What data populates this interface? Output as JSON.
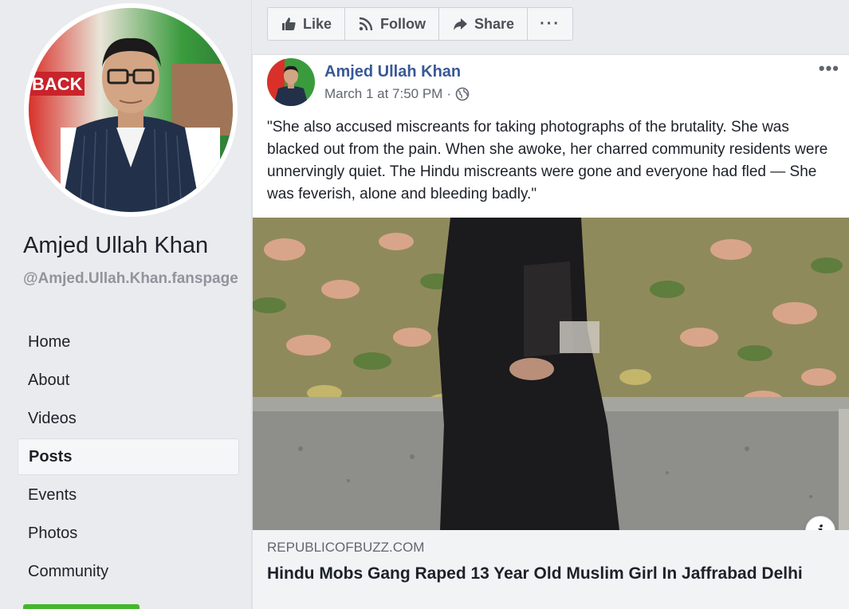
{
  "sidebar": {
    "page_name": "Amjed Ullah Khan",
    "handle": "@Amjed.Ullah.Khan.fanspage",
    "nav_items": [
      {
        "label": "Home",
        "active": false
      },
      {
        "label": "About",
        "active": false
      },
      {
        "label": "Videos",
        "active": false
      },
      {
        "label": "Posts",
        "active": true
      },
      {
        "label": "Events",
        "active": false
      },
      {
        "label": "Photos",
        "active": false
      },
      {
        "label": "Community",
        "active": false
      }
    ],
    "banner_text": "BACK"
  },
  "actions": {
    "like": "Like",
    "follow": "Follow",
    "share": "Share",
    "more": "···"
  },
  "post": {
    "author": "Amjed Ullah Khan",
    "date": "March 1 at 7:50 PM",
    "separator": "·",
    "menu": "•••",
    "text": "\"She also accused miscreants for taking photographs of the brutality. She was blacked out from the pain. When she awoke, her charred community residents were unnervingly quiet. The Hindu miscreants were gone and everyone had fled — She was feverish, alone and bleeding badly.\"",
    "info_glyph": "i",
    "link": {
      "domain": "REPUBLICOFBUZZ.COM",
      "title": "Hindu Mobs Gang Raped 13 Year Old Muslim Girl In Jaffrabad Delhi"
    }
  },
  "colors": {
    "accent_link": "#385898",
    "page_bg": "#e9ebee",
    "card_bg": "#ffffff",
    "preview_bg": "#f2f3f5",
    "green": "#42b72a"
  }
}
